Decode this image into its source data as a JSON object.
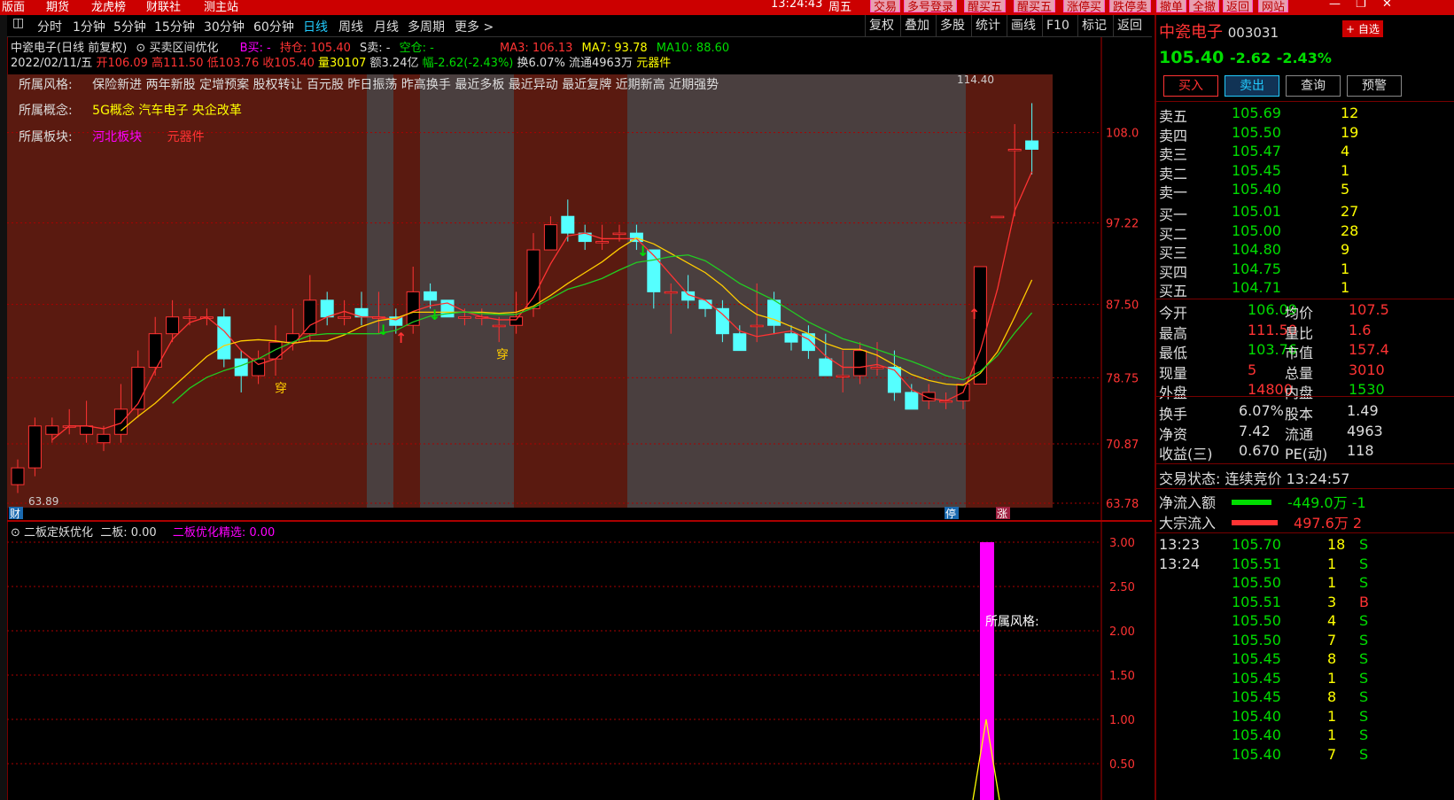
{
  "menu": {
    "items": [
      "版面",
      "期货",
      "龙虎榜",
      "财联社",
      "测主站"
    ],
    "time": "13:24:43",
    "weekday": "周五",
    "buttons": [
      "交易",
      "多号登录",
      "醒买五",
      "醒买五",
      "涨停买",
      "跌停卖",
      "撤单",
      "全撤",
      "返回",
      "网站"
    ]
  },
  "toolbar": {
    "periods": [
      "分时",
      "1分钟",
      "5分钟",
      "15分钟",
      "30分钟",
      "60分钟",
      "日线",
      "周线",
      "月线",
      "多周期",
      "更多 >"
    ],
    "right": [
      "复权",
      "叠加",
      "多股",
      "统计",
      "画线",
      "F10",
      "标记",
      "返回"
    ]
  },
  "stock": {
    "name": "中瓷电子",
    "code": "003031",
    "chart_title": "中瓷电子(日线 前复权)",
    "indicator": "买卖区间优化",
    "b_buy": "B买: -",
    "hold": "持仓: 105.40",
    "s_sell": "S卖: -",
    "empty": "空仓: -",
    "ma3": "MA3: 106.13",
    "ma7": "MA7: 93.78",
    "ma10": "MA10: 88.60"
  },
  "ohlc": {
    "date": "2022/02/11/五",
    "open": "开106.09",
    "high": "高111.50",
    "low": "低103.76",
    "close": "收105.40",
    "vol": "量30107",
    "amount": "额3.24亿",
    "chg": "幅-2.62(-2.43%)",
    "turn": "换6.07%",
    "float": "流通4963万",
    "sector": "元器件"
  },
  "tags": {
    "style_label": "所属风格:",
    "style": "保险新进 两年新股 定增预案 股权转让 百元股 昨日振荡 昨高换手 最近多板 最近异动 最近复牌 近期新高 近期强势",
    "concept_label": "所属概念:",
    "concept": "5G概念 汽车电子 央企改革",
    "board_label": "所属板块:",
    "board1": "河北板块",
    "board2": "元器件"
  },
  "chart_data": {
    "type": "candlestick",
    "y_ticks": [
      "108.0",
      "97.22",
      "87.50",
      "78.75",
      "70.87",
      "63.78"
    ],
    "low_label": "63.89",
    "high_label": "114.40",
    "markers": [
      "穿",
      "穿",
      "穿"
    ],
    "bottom_tags": [
      "财",
      "停",
      "涨"
    ],
    "sub_title": "二板定妖优化",
    "sub_val": "二板: 0.00",
    "sub_sel": "二板优化精选: 0.00",
    "sub_ticks": [
      "3.00",
      "2.50",
      "2.00",
      "1.50",
      "1.00",
      "0.50"
    ],
    "sub_note": "所属风格:"
  },
  "quote": {
    "name": "中瓷电子",
    "code": "003031",
    "add": "+ 自选",
    "price": "105.40",
    "chg": "-2.62",
    "pct": "-2.43%",
    "buttons": [
      "买入",
      "卖出",
      "查询",
      "预警"
    ],
    "asks": [
      {
        "l": "卖五",
        "p": "105.69",
        "v": "12"
      },
      {
        "l": "卖四",
        "p": "105.50",
        "v": "19"
      },
      {
        "l": "卖三",
        "p": "105.47",
        "v": "4"
      },
      {
        "l": "卖二",
        "p": "105.45",
        "v": "1"
      },
      {
        "l": "卖一",
        "p": "105.40",
        "v": "5"
      }
    ],
    "bids": [
      {
        "l": "买一",
        "p": "105.01",
        "v": "27"
      },
      {
        "l": "买二",
        "p": "105.00",
        "v": "28"
      },
      {
        "l": "买三",
        "p": "104.80",
        "v": "9"
      },
      {
        "l": "买四",
        "p": "104.75",
        "v": "1"
      },
      {
        "l": "买五",
        "p": "104.71",
        "v": "1"
      }
    ],
    "stats": [
      [
        "今开",
        "106.09",
        "均价",
        "107.5"
      ],
      [
        "最高",
        "111.50",
        "量比",
        "1.6"
      ],
      [
        "最低",
        "103.76",
        "市值",
        "157.4"
      ],
      [
        "现量",
        "5",
        "总量",
        "3010"
      ],
      [
        "外盘",
        "14800",
        "内盘",
        "1530"
      ]
    ],
    "stats2": [
      [
        "换手",
        "6.07%",
        "股本",
        "1.49"
      ],
      [
        "净资",
        "7.42",
        "流通",
        "4963"
      ],
      [
        "收益(三)",
        "0.670",
        "PE(动)",
        "118"
      ]
    ],
    "trade_status": "交易状态: 连续竞价",
    "trade_time": "13:24:57",
    "netflow_label": "净流入额",
    "netflow": "-449.0万",
    "netflow2": "-1",
    "block_label": "大宗流入",
    "block": "497.6万",
    "block2": "2",
    "ticks": [
      [
        "13:23",
        "105.70",
        "18",
        "S"
      ],
      [
        "13:24",
        "105.51",
        "1",
        "S"
      ],
      [
        "",
        "105.50",
        "1",
        "S"
      ],
      [
        "",
        "105.51",
        "3",
        "B"
      ],
      [
        "",
        "105.50",
        "4",
        "S"
      ],
      [
        "",
        "105.50",
        "7",
        "S"
      ],
      [
        "",
        "105.45",
        "8",
        "S"
      ],
      [
        "",
        "105.45",
        "1",
        "S"
      ],
      [
        "",
        "105.45",
        "8",
        "S"
      ],
      [
        "",
        "105.40",
        "1",
        "S"
      ],
      [
        "",
        "105.40",
        "1",
        "S"
      ],
      [
        "",
        "105.40",
        "7",
        "S"
      ]
    ]
  }
}
